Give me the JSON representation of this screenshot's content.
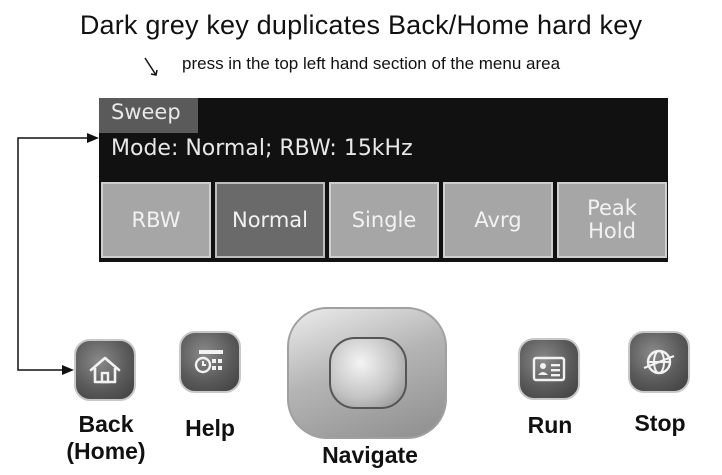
{
  "annotation": {
    "headline": "Dark grey key duplicates Back/Home hard key",
    "subline": "press in the top left hand section of the menu area"
  },
  "screen": {
    "sweep_label": "Sweep",
    "mode_line": "Mode: Normal; RBW: 15kHz",
    "softkeys": [
      {
        "label": "RBW",
        "selected": false
      },
      {
        "label": "Normal",
        "selected": true
      },
      {
        "label": "Single",
        "selected": false
      },
      {
        "label": "Avrg",
        "selected": false
      },
      {
        "label": "Peak\nHold",
        "selected": false
      }
    ]
  },
  "hard_keys": {
    "back_line1": "Back",
    "back_line2": "(Home)",
    "help": "Help",
    "navigate": "Navigate",
    "run": "Run",
    "stop": "Stop"
  },
  "icons": {
    "back": "home-icon",
    "help": "help-icon",
    "run": "run-icon",
    "stop": "globe-icon"
  },
  "colors": {
    "screen_bg": "#111111",
    "softkey": "#a6a6a6",
    "softkey_selected": "#6a6a6a",
    "hardkey": "#5a5a5a"
  }
}
